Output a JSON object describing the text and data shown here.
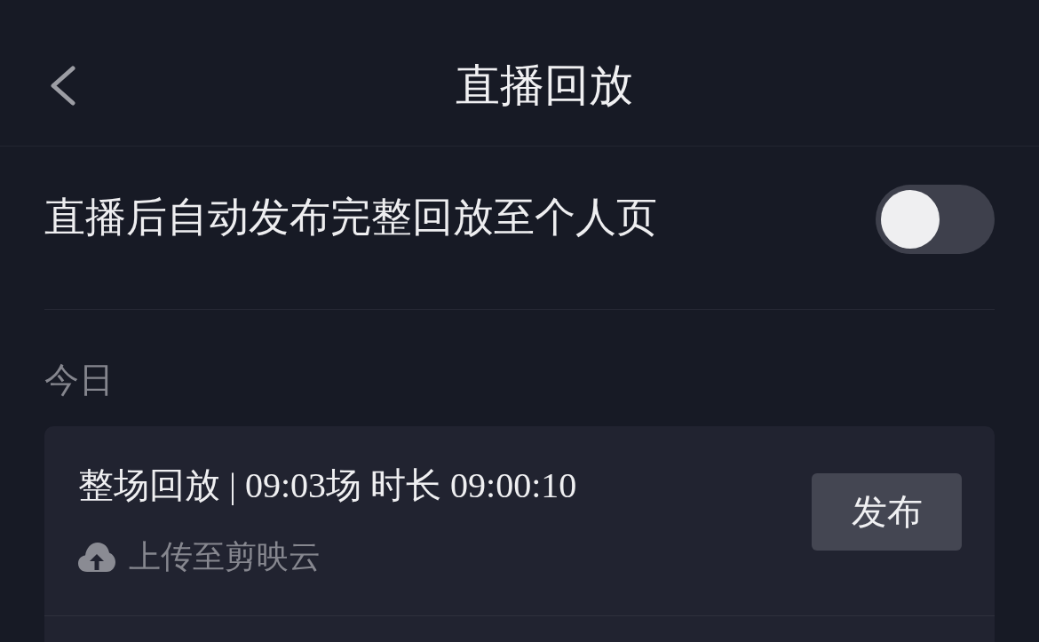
{
  "header": {
    "title": "直播回放"
  },
  "settings": [
    {
      "label": "直播后自动发布完整回放至个人页",
      "on": false
    }
  ],
  "sections": [
    {
      "heading": "今日",
      "items": [
        {
          "title": "整场回放 | 09:03场 时长 09:00:10",
          "upload_status": "上传至剪映云",
          "button": "发布"
        }
      ]
    }
  ]
}
